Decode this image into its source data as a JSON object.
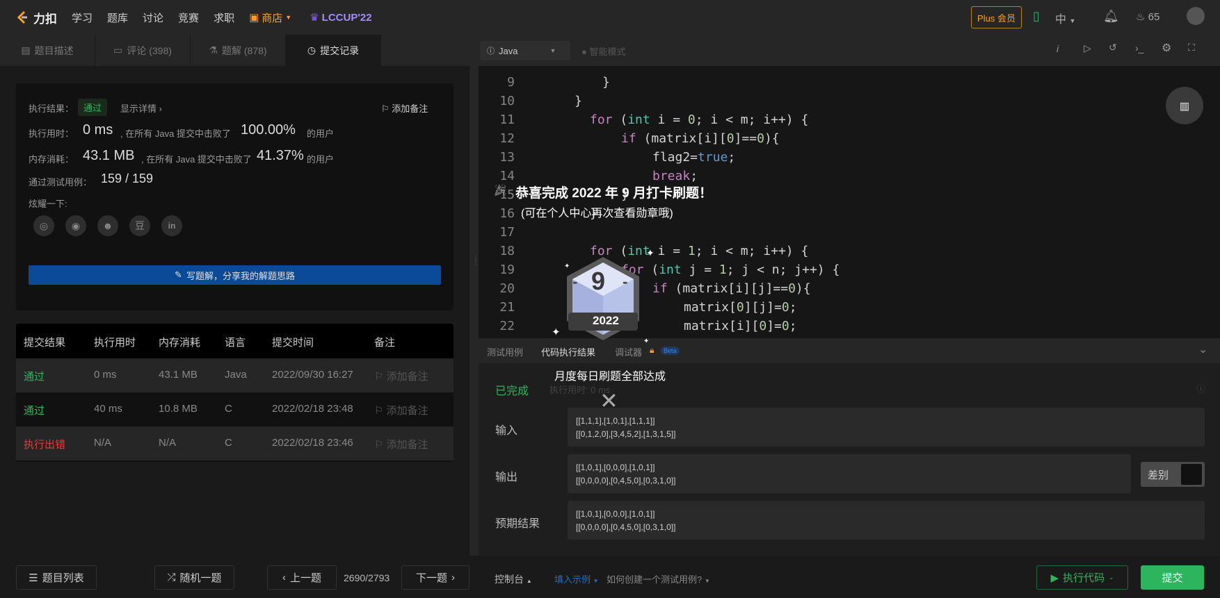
{
  "nav": {
    "brand": "力扣",
    "links": [
      "学习",
      "题库",
      "讨论",
      "竞赛",
      "求职"
    ],
    "shop": "商店",
    "event": "LCCUP'22",
    "plus": "Plus 会员",
    "lang": "中",
    "points": "65"
  },
  "left_tabs": [
    {
      "label": "题目描述"
    },
    {
      "label": "评论 (398)"
    },
    {
      "label": "题解 (878)"
    },
    {
      "label": "提交记录"
    }
  ],
  "result": {
    "label_result": "执行结果：",
    "status": "通过",
    "detail_link": "显示详情 ›",
    "add_note": "添加备注",
    "label_time": "执行用时：",
    "time_val": "0 ms",
    "time_text": ", 在所有 Java 提交中击败了",
    "time_pct": "100.00%",
    "users": "的用户",
    "label_mem": "内存消耗：",
    "mem_val": "43.1 MB",
    "mem_text": ", 在所有 Java 提交中击败了",
    "mem_pct": "41.37%",
    "label_cases": "通过测试用例：",
    "cases_val": "159 / 159",
    "label_share": "炫耀一下:",
    "write_btn": "写题解，分享我的解题思路"
  },
  "submissions": {
    "headers": [
      "提交结果",
      "执行用时",
      "内存消耗",
      "语言",
      "提交时间",
      "备注"
    ],
    "rows": [
      {
        "status": "通过",
        "time": "0 ms",
        "mem": "43.1 MB",
        "lang": "Java",
        "date": "2022/09/30 16:27",
        "note": "添加备注"
      },
      {
        "status": "通过",
        "time": "40 ms",
        "mem": "10.8 MB",
        "lang": "C",
        "date": "2022/02/18 23:48",
        "note": "添加备注"
      },
      {
        "status": "执行出错",
        "time": "N/A",
        "mem": "N/A",
        "lang": "C",
        "date": "2022/02/18 23:46",
        "note": "添加备注"
      }
    ]
  },
  "bottom": {
    "list": "题目列表",
    "random": "随机一题",
    "prev": "上一题",
    "page": "2690/2793",
    "next": "下一题",
    "console": "控制台",
    "fill_example": "填入示例",
    "how_create": "如何创建一个测试用例?",
    "run": "执行代码",
    "submit": "提交"
  },
  "editor": {
    "language": "Java",
    "smart_mode": "智能模式"
  },
  "code": [
    {
      "n": "9",
      "text": "        }"
    },
    {
      "n": "10",
      "text": "    }"
    },
    {
      "n": "11",
      "text": "    for (int i = 0; i < m; i++) {"
    },
    {
      "n": "12",
      "text": "        if (matrix[i][0]==0){"
    },
    {
      "n": "13",
      "text": "            flag2=true;"
    },
    {
      "n": "14",
      "text": "            break;"
    },
    {
      "n": "15",
      "text": "        }"
    },
    {
      "n": "16",
      "text": "    }"
    },
    {
      "n": "17",
      "text": ""
    },
    {
      "n": "18",
      "text": "    for (int i = 1; i < m; i++) {"
    },
    {
      "n": "19",
      "text": "        for (int j = 1; j < n; j++) {"
    },
    {
      "n": "20",
      "text": "            if (matrix[i][j]==0){"
    },
    {
      "n": "21",
      "text": "                matrix[0][j]=0;"
    },
    {
      "n": "22",
      "text": "                matrix[i][0]=0;"
    }
  ],
  "results_panel": {
    "tabs": [
      "测试用例",
      "代码执行结果",
      "调试器",
      "Beta"
    ],
    "status": "已完成",
    "exec_time": "执行用时: 0 ms",
    "input_label": "输入",
    "input_lines": [
      "[[1,1,1],[1,0,1],[1,1,1]]",
      "[[0,1,2,0],[3,4,5,2],[1,3,1,5]]"
    ],
    "output_label": "输出",
    "output_lines": [
      "[[1,0,1],[0,0,0],[1,0,1]]",
      "[[0,0,0,0],[0,4,5,0],[0,3,1,0]]"
    ],
    "expected_label": "预期结果",
    "expected_lines": [
      "[[1,0,1],[0,0,0],[1,0,1]]",
      "[[0,0,0,0],[0,4,5,0],[0,3,1,0]]"
    ],
    "diff": "差别"
  },
  "badge": {
    "title": "恭喜完成 2022 年 9 月打卡刷题！",
    "subtitle": "(可在个人中心再次查看勋章哦)",
    "number": "9",
    "year": "2022",
    "caption": "月度每日刷题全部达成"
  },
  "colors": {
    "pass": "#2db55d",
    "error": "#e03e3e",
    "accent": "#ffa116",
    "submit": "#2db55d"
  }
}
